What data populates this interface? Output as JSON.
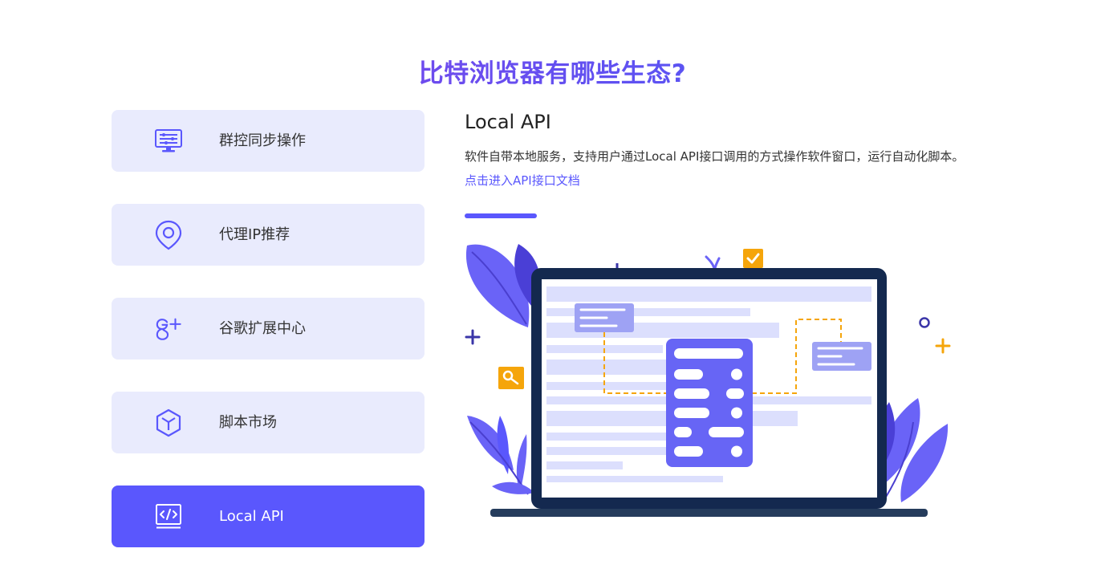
{
  "section": {
    "title": "比特浏览器有哪些生态?"
  },
  "features": [
    {
      "label": "群控同步操作",
      "icon": "monitor-settings-icon",
      "active": false
    },
    {
      "label": "代理IP推荐",
      "icon": "location-pin-icon",
      "active": false
    },
    {
      "label": "谷歌扩展中心",
      "icon": "google-plus-icon",
      "active": false
    },
    {
      "label": "脚本市场",
      "icon": "cube-icon",
      "active": false
    },
    {
      "label": "Local API",
      "icon": "code-window-icon",
      "active": true
    }
  ],
  "detail": {
    "title": "Local API",
    "description": "软件自带本地服务，支持用户通过Local API接口调用的方式操作软件窗口，运行自动化脚本。",
    "link_text": "点击进入API接口文档"
  },
  "colors": {
    "accent": "#5a57fd",
    "item_bg": "#e9ebfd",
    "title_gradient_start": "#8a3fe6",
    "title_gradient_end": "#4f67f5",
    "illustration_orange": "#f5a50b",
    "laptop_frame": "#14294f"
  }
}
